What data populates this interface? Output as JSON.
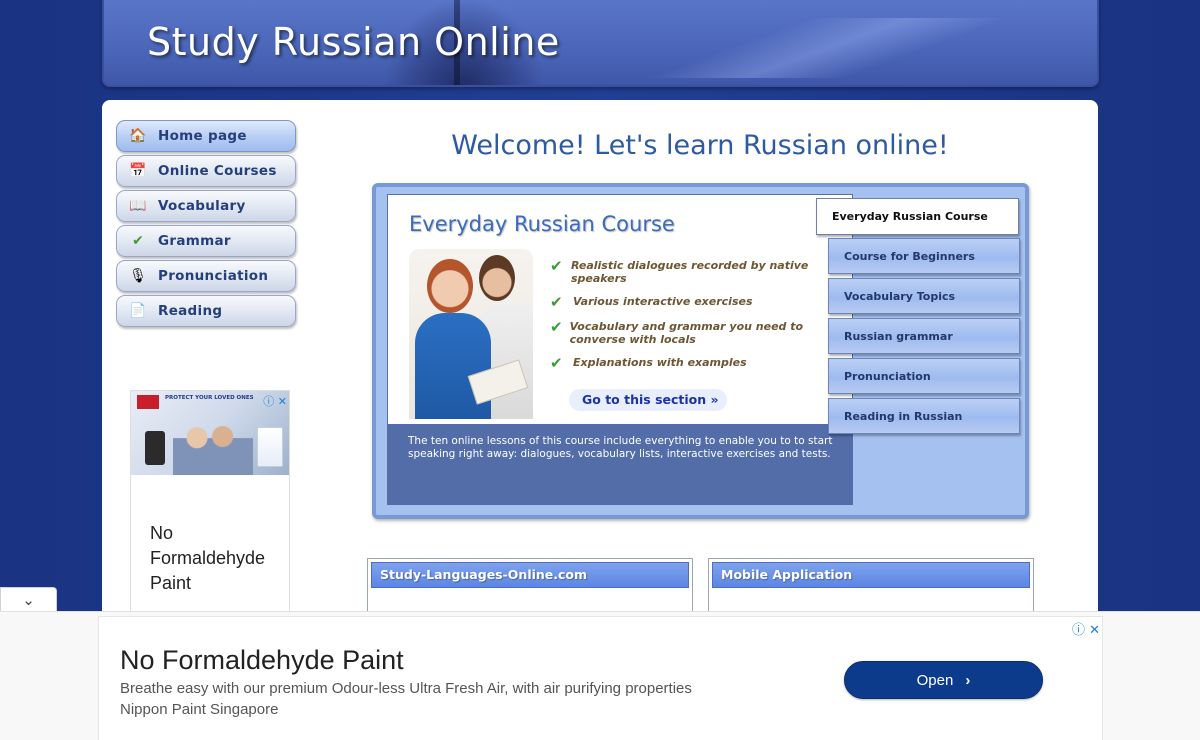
{
  "site": {
    "title": "Study Russian Online"
  },
  "nav": {
    "items": [
      {
        "label": "Home page",
        "icon": "home-icon",
        "glyph": "🏠",
        "active": true
      },
      {
        "label": "Online Courses",
        "icon": "calendar-icon",
        "glyph": "📅",
        "active": false
      },
      {
        "label": "Vocabulary",
        "icon": "book-icon",
        "glyph": "📖",
        "active": false
      },
      {
        "label": "Grammar",
        "icon": "spellcheck-icon",
        "glyph": "✔",
        "active": false
      },
      {
        "label": "Pronunciation",
        "icon": "microphone-icon",
        "glyph": "🎙",
        "active": false
      },
      {
        "label": "Reading",
        "icon": "document-icon",
        "glyph": "📄",
        "active": false
      }
    ]
  },
  "side_ad": {
    "text": "No Formaldehyde Paint",
    "tagline": "PROTECT YOUR LOVED ONES",
    "icons": "ⓘ ✕"
  },
  "main": {
    "welcome": "Welcome! Let's learn Russian online!",
    "feature": {
      "title": "Everyday Russian Course",
      "bullets": [
        "Realistic dialogues recorded by native speakers",
        "Various interactive exercises",
        "Vocabulary and grammar you need to converse with locals",
        "Explanations with examples"
      ],
      "link": "Go to this section »",
      "description": "The ten online lessons of this course include everything to enable you to to start speaking right away: dialogues, vocabulary lists, interactive exercises and tests."
    },
    "course_tabs": [
      {
        "label": "Everyday Russian Course",
        "active": true
      },
      {
        "label": "Course for Beginners",
        "active": false
      },
      {
        "label": "Vocabulary Topics",
        "active": false
      },
      {
        "label": "Russian grammar",
        "active": false
      },
      {
        "label": "Pronunciation",
        "active": false
      },
      {
        "label": "Reading in Russian",
        "active": false
      }
    ],
    "boxes": [
      {
        "header": "Study-Languages-Online.com"
      },
      {
        "header": "Mobile Application"
      }
    ]
  },
  "bottom_ad": {
    "headline": "No Formaldehyde Paint",
    "line1": "Breathe easy with our premium Odour-less Ultra Fresh Air, with air purifying properties",
    "line2": "Nippon Paint Singapore",
    "button": "Open",
    "chevron": "›",
    "icons": "ⓘ ✕"
  },
  "collapse": {
    "glyph": "⌄"
  },
  "colors": {
    "background": "#1e3a8c",
    "title_blue": "#2d5aa0",
    "open_button": "#0d3b8c"
  }
}
